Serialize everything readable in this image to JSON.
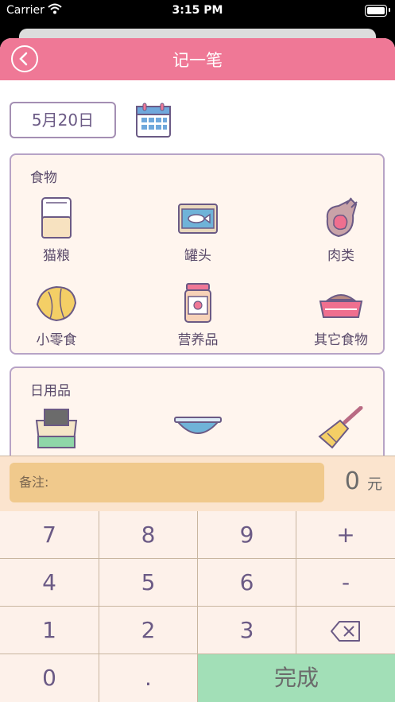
{
  "status_bar": {
    "carrier": "Carrier",
    "time": "3:15 PM"
  },
  "nav": {
    "title": "记一笔"
  },
  "date": {
    "value": "5月20日"
  },
  "categories": {
    "food": {
      "title": "食物",
      "items": [
        {
          "label": "猫粮",
          "icon": "cat-food-bag-icon"
        },
        {
          "label": "罐头",
          "icon": "fish-can-icon"
        },
        {
          "label": "肉类",
          "icon": "meat-icon"
        },
        {
          "label": "小零食",
          "icon": "croissant-icon"
        },
        {
          "label": "营养品",
          "icon": "supplement-jar-icon"
        },
        {
          "label": "其它食物",
          "icon": "food-bowl-icon"
        }
      ]
    },
    "daily": {
      "title": "日用品",
      "items": [
        {
          "label": "",
          "icon": "litter-box-icon"
        },
        {
          "label": "",
          "icon": "bowl-icon"
        },
        {
          "label": "",
          "icon": "brush-icon"
        }
      ]
    }
  },
  "remark": {
    "label": "备注:",
    "amount": "0",
    "unit": "元"
  },
  "keypad": {
    "k7": "7",
    "k8": "8",
    "k9": "9",
    "plus": "+",
    "k4": "4",
    "k5": "5",
    "k6": "6",
    "minus": "-",
    "k1": "1",
    "k2": "2",
    "k3": "3",
    "k0": "0",
    "dot": ".",
    "done": "完成"
  },
  "colors": {
    "nav": "#ef7896",
    "card_bg": "#fff5ee",
    "remark_input": "#f0c98c",
    "done_key": "#a2dfb7"
  }
}
